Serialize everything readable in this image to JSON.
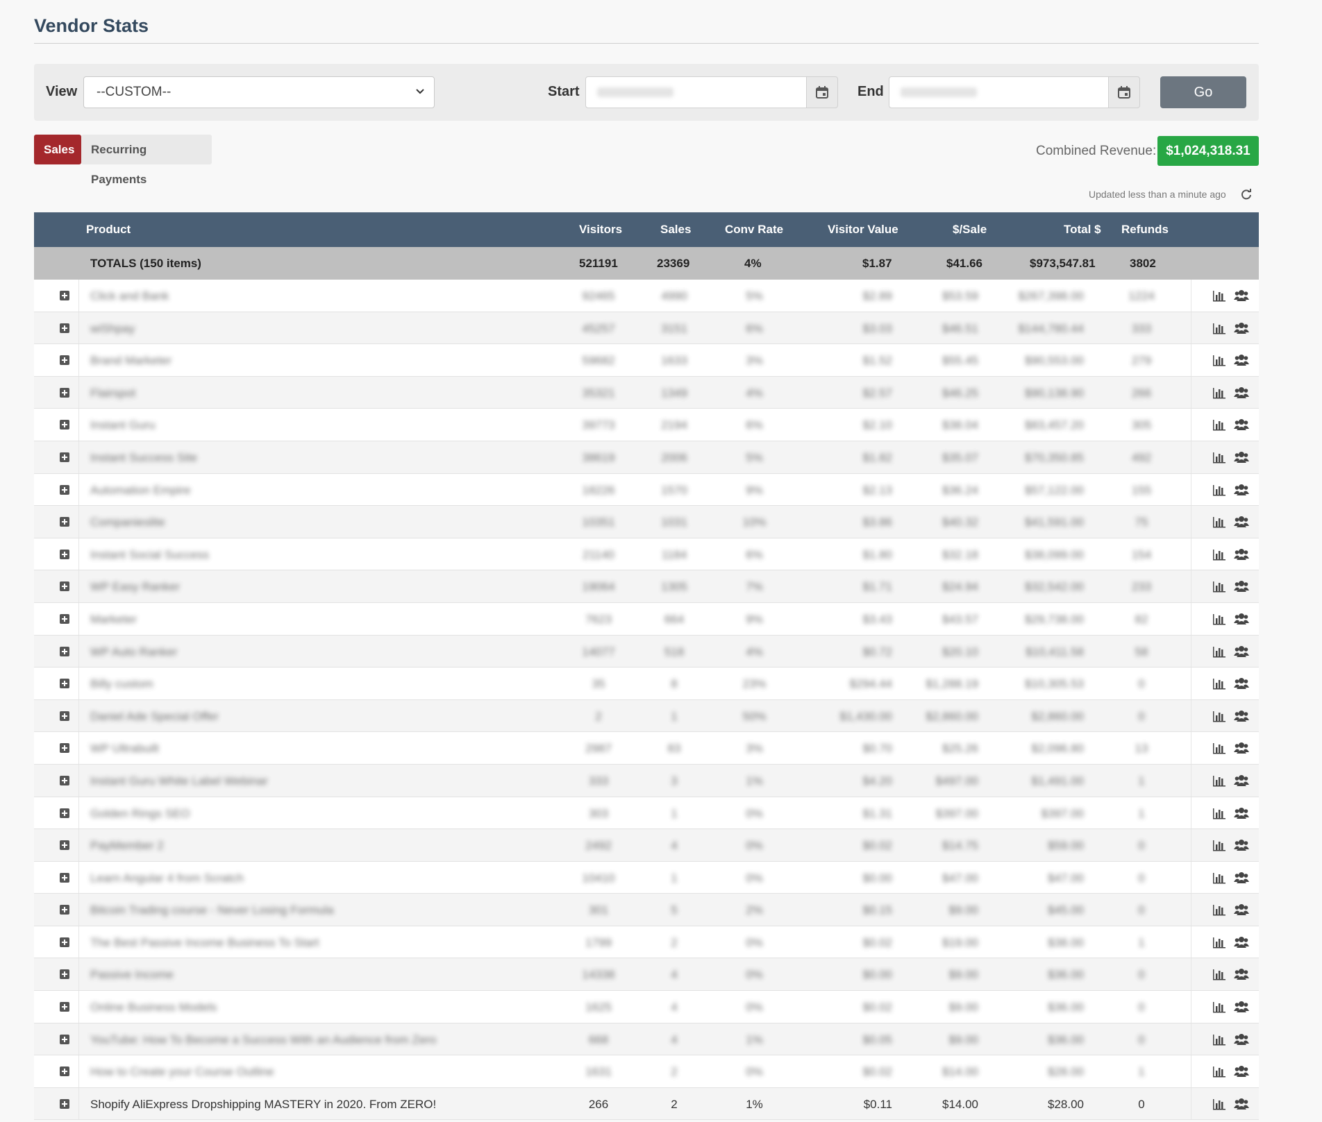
{
  "page": {
    "title": "Vendor Stats"
  },
  "filters": {
    "view_label": "View",
    "view_value": "--CUSTOM--",
    "start_label": "Start",
    "start_value": "",
    "end_label": "End",
    "end_value": "",
    "go_label": "Go"
  },
  "tabs": [
    {
      "label": "Sales",
      "active": true
    },
    {
      "label": "Recurring Payments",
      "active": false
    }
  ],
  "combined_revenue": {
    "label": "Combined Revenue:",
    "value": "$1,024,318.31"
  },
  "status": {
    "updated_text": "Updated less than a minute ago"
  },
  "table": {
    "columns": [
      "Product",
      "Visitors",
      "Sales",
      "Conv Rate",
      "Visitor Value",
      "$/Sale",
      "Total $",
      "Refunds"
    ],
    "totals": {
      "label": "TOTALS (150 items)",
      "visitors": "521191",
      "sales": "23369",
      "conv_rate": "4%",
      "visitor_value": "$1.87",
      "per_sale": "$41.66",
      "total": "$973,547.81",
      "refunds": "3802"
    },
    "rows": [
      {
        "product": "Click and Bank",
        "visitors": "92465",
        "sales": "4990",
        "conv": "5%",
        "vv": "$2.89",
        "ps": "$53.59",
        "total": "$267,398.00",
        "refunds": "1224"
      },
      {
        "product": "wiShpay",
        "visitors": "45257",
        "sales": "3151",
        "conv": "6%",
        "vv": "$3.03",
        "ps": "$46.51",
        "total": "$144,780.44",
        "refunds": "333"
      },
      {
        "product": "Brand Marketer",
        "visitors": "59682",
        "sales": "1633",
        "conv": "3%",
        "vv": "$1.52",
        "ps": "$55.45",
        "total": "$90,553.00",
        "refunds": "279"
      },
      {
        "product": "Flairspot",
        "visitors": "35321",
        "sales": "1349",
        "conv": "4%",
        "vv": "$2.57",
        "ps": "$46.25",
        "total": "$90,138.90",
        "refunds": "266"
      },
      {
        "product": "Instant Guru",
        "visitors": "39773",
        "sales": "2194",
        "conv": "6%",
        "vv": "$2.10",
        "ps": "$38.04",
        "total": "$83,457.20",
        "refunds": "305"
      },
      {
        "product": "Instant Success Site",
        "visitors": "38619",
        "sales": "2006",
        "conv": "5%",
        "vv": "$1.82",
        "ps": "$35.07",
        "total": "$70,350.85",
        "refunds": "492"
      },
      {
        "product": "Automation Empire",
        "visitors": "18226",
        "sales": "1570",
        "conv": "9%",
        "vv": "$2.13",
        "ps": "$36.24",
        "total": "$57,122.00",
        "refunds": "155"
      },
      {
        "product": "Companieslite",
        "visitors": "10351",
        "sales": "1031",
        "conv": "10%",
        "vv": "$3.86",
        "ps": "$40.32",
        "total": "$41,591.00",
        "refunds": "75"
      },
      {
        "product": "Instant Social Success",
        "visitors": "21140",
        "sales": "1184",
        "conv": "6%",
        "vv": "$1.80",
        "ps": "$32.18",
        "total": "$38,099.00",
        "refunds": "154"
      },
      {
        "product": "WP Easy Ranker",
        "visitors": "19064",
        "sales": "1305",
        "conv": "7%",
        "vv": "$1.71",
        "ps": "$24.94",
        "total": "$32,542.00",
        "refunds": "233"
      },
      {
        "product": "Marketer",
        "visitors": "7623",
        "sales": "664",
        "conv": "9%",
        "vv": "$3.43",
        "ps": "$43.57",
        "total": "$29,738.00",
        "refunds": "82"
      },
      {
        "product": "WP Auto Ranker",
        "visitors": "14077",
        "sales": "518",
        "conv": "4%",
        "vv": "$0.72",
        "ps": "$20.10",
        "total": "$10,411.58",
        "refunds": "58"
      },
      {
        "product": "Billy custom",
        "visitors": "35",
        "sales": "8",
        "conv": "23%",
        "vv": "$294.44",
        "ps": "$1,288.19",
        "total": "$10,305.53",
        "refunds": "0"
      },
      {
        "product": "Daniel Ade Special Offer",
        "visitors": "2",
        "sales": "1",
        "conv": "50%",
        "vv": "$1,430.00",
        "ps": "$2,860.00",
        "total": "$2,860.00",
        "refunds": "0"
      },
      {
        "product": "WP Ultrabuilt",
        "visitors": "2987",
        "sales": "83",
        "conv": "3%",
        "vv": "$0.70",
        "ps": "$25.26",
        "total": "$2,096.80",
        "refunds": "13"
      },
      {
        "product": "Instant Guru White Label Webinar",
        "visitors": "333",
        "sales": "3",
        "conv": "1%",
        "vv": "$4.20",
        "ps": "$497.00",
        "total": "$1,491.00",
        "refunds": "1"
      },
      {
        "product": "Golden Rings SEO",
        "visitors": "303",
        "sales": "1",
        "conv": "0%",
        "vv": "$1.31",
        "ps": "$397.00",
        "total": "$397.00",
        "refunds": "1"
      },
      {
        "product": "PayMember 2",
        "visitors": "2492",
        "sales": "4",
        "conv": "0%",
        "vv": "$0.02",
        "ps": "$14.75",
        "total": "$59.00",
        "refunds": "0"
      },
      {
        "product": "Learn Angular 4 from Scratch",
        "visitors": "10410",
        "sales": "1",
        "conv": "0%",
        "vv": "$0.00",
        "ps": "$47.00",
        "total": "$47.00",
        "refunds": "0"
      },
      {
        "product": "Bitcoin Trading course - Never Losing Formula",
        "visitors": "301",
        "sales": "5",
        "conv": "2%",
        "vv": "$0.15",
        "ps": "$9.00",
        "total": "$45.00",
        "refunds": "0"
      },
      {
        "product": "The Best Passive Income Business To Start",
        "visitors": "1799",
        "sales": "2",
        "conv": "0%",
        "vv": "$0.02",
        "ps": "$19.00",
        "total": "$38.00",
        "refunds": "1"
      },
      {
        "product": "Passive Income",
        "visitors": "14338",
        "sales": "4",
        "conv": "0%",
        "vv": "$0.00",
        "ps": "$9.00",
        "total": "$36.00",
        "refunds": "0"
      },
      {
        "product": "Online Business Models",
        "visitors": "1625",
        "sales": "4",
        "conv": "0%",
        "vv": "$0.02",
        "ps": "$9.00",
        "total": "$36.00",
        "refunds": "0"
      },
      {
        "product": "YouTube: How To Become a Success With an Audience from Zero",
        "visitors": "668",
        "sales": "4",
        "conv": "1%",
        "vv": "$0.05",
        "ps": "$9.00",
        "total": "$36.00",
        "refunds": "0"
      },
      {
        "product": "How to Create your Course Outline",
        "visitors": "1631",
        "sales": "2",
        "conv": "0%",
        "vv": "$0.02",
        "ps": "$14.00",
        "total": "$28.00",
        "refunds": "1"
      },
      {
        "product": "Shopify AliExpress Dropshipping MASTERY in 2020. From ZERO!",
        "visitors": "266",
        "sales": "2",
        "conv": "1%",
        "vv": "$0.11",
        "ps": "$14.00",
        "total": "$28.00",
        "refunds": "0",
        "clear": true
      }
    ]
  },
  "icons": {
    "expand": "plus-square-icon",
    "chart": "bar-chart-icon",
    "users": "users-icon",
    "calendar": "calendar-icon",
    "refresh": "refresh-icon"
  },
  "colors": {
    "header_bg": "#4a5f75",
    "totals_bg": "#bfbfbf",
    "sales_tab": "#a4282c",
    "revenue_badge": "#28a745",
    "go_button": "#6c7680"
  }
}
